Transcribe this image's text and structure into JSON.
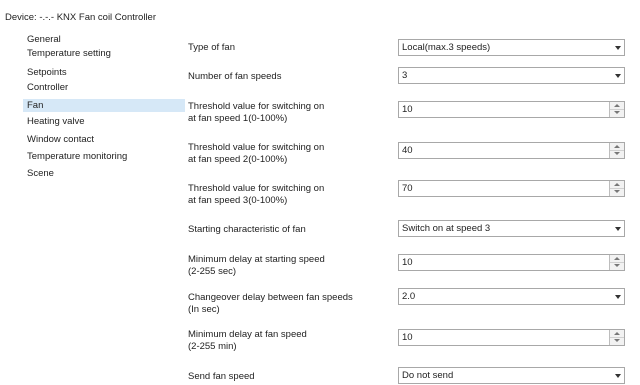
{
  "window": {
    "title": "Device: -.-.-  KNX Fan coil Controller"
  },
  "sidebar": {
    "items": [
      {
        "label": "General",
        "selected": false
      },
      {
        "label": "Temperature setting",
        "selected": false
      },
      {
        "label": "Setpoints",
        "selected": false
      },
      {
        "label": "Controller",
        "selected": false
      },
      {
        "label": "Fan",
        "selected": true
      },
      {
        "label": "Heating valve",
        "selected": false
      },
      {
        "label": "Window contact",
        "selected": false
      },
      {
        "label": "Temperature monitoring",
        "selected": false
      },
      {
        "label": "Scene",
        "selected": false
      }
    ]
  },
  "params": [
    {
      "label_lines": [
        "Type of fan"
      ],
      "type": "select",
      "value": "Local(max.3 speeds)"
    },
    {
      "label_lines": [
        "Number of fan speeds"
      ],
      "type": "select",
      "value": "3"
    },
    {
      "label_lines": [
        "Threshold value for switching on",
        "at fan speed 1(0-100%)"
      ],
      "type": "spin",
      "value": "10"
    },
    {
      "label_lines": [
        "Threshold value for switching on",
        "at fan speed 2(0-100%)"
      ],
      "type": "spin",
      "value": "40"
    },
    {
      "label_lines": [
        "Threshold value for switching on",
        "at fan speed 3(0-100%)"
      ],
      "type": "spin",
      "value": "70"
    },
    {
      "label_lines": [
        "Starting characteristic of fan"
      ],
      "type": "select",
      "value": "Switch on at speed 3"
    },
    {
      "label_lines": [
        "Minimum delay at starting speed",
        "(2-255 sec)"
      ],
      "type": "spin",
      "value": "10"
    },
    {
      "label_lines": [
        "Changeover delay between fan speeds",
        "(In sec)"
      ],
      "type": "select",
      "value": "2.0"
    },
    {
      "label_lines": [
        "Minimum delay at fan speed",
        "(2-255 min)"
      ],
      "type": "spin",
      "value": "10"
    },
    {
      "label_lines": [
        "Send fan speed"
      ],
      "type": "select",
      "value": "Do not send"
    }
  ]
}
